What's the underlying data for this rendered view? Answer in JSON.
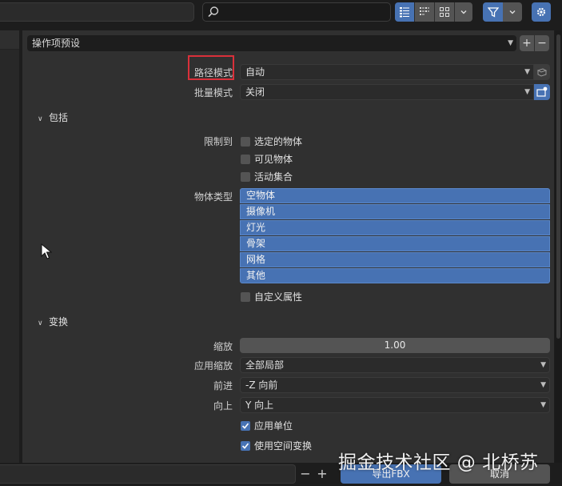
{
  "header": {
    "search_placeholder": ""
  },
  "preset": {
    "label": "操作项预设",
    "add": "+",
    "remove": "−"
  },
  "path_mode": {
    "label": "路径模式",
    "value": "自动"
  },
  "batch_mode": {
    "label": "批量模式",
    "value": "关闭"
  },
  "include": {
    "title": "包括",
    "limit_label": "限制到",
    "limit_options": [
      {
        "label": "选定的物体",
        "checked": false
      },
      {
        "label": "可见物体",
        "checked": false
      },
      {
        "label": "活动集合",
        "checked": false
      }
    ],
    "object_types_label": "物体类型",
    "object_types": [
      "空物体",
      "摄像机",
      "灯光",
      "骨架",
      "网格",
      "其他"
    ],
    "custom_props": {
      "label": "自定义属性",
      "checked": false
    }
  },
  "transform": {
    "title": "变换",
    "scale_label": "缩放",
    "scale_value": "1.00",
    "apply_scale_label": "应用缩放",
    "apply_scale_value": "全部局部",
    "forward_label": "前进",
    "forward_value": "-Z 向前",
    "up_label": "向上",
    "up_value": "Y 向上",
    "apply_unit": {
      "label": "应用单位",
      "checked": true
    },
    "use_space_transform": {
      "label": "使用空间变换",
      "checked": true
    }
  },
  "footer": {
    "minus": "−",
    "plus": "+",
    "export_label": "导出FBX",
    "cancel_label": "取消"
  },
  "watermark": "掘金技术社区 @ 北桥苏",
  "colors": {
    "accent": "#4772b3",
    "panel": "#303030",
    "highlight_box": "#d9303a"
  }
}
